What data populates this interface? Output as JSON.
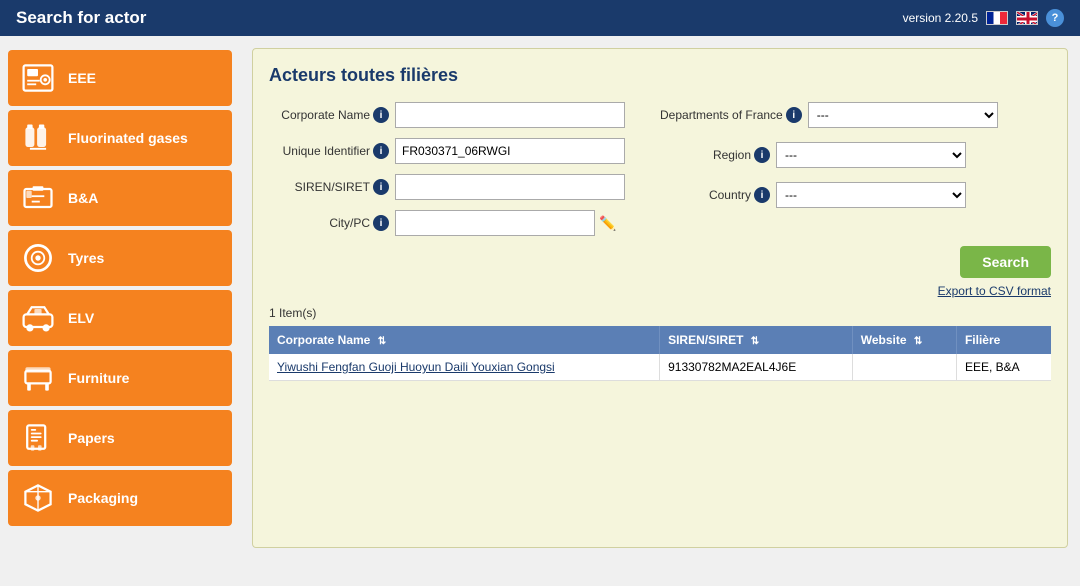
{
  "header": {
    "title": "Search for actor",
    "version": "version 2.20.5"
  },
  "sidebar": {
    "items": [
      {
        "id": "eee",
        "label": "EEE",
        "icon": "washer"
      },
      {
        "id": "fluorinated-gases",
        "label": "Fluorinated gases",
        "icon": "gas"
      },
      {
        "id": "bna",
        "label": "B&A",
        "icon": "battery"
      },
      {
        "id": "tyres",
        "label": "Tyres",
        "icon": "tyre"
      },
      {
        "id": "elv",
        "label": "ELV",
        "icon": "car"
      },
      {
        "id": "furniture",
        "label": "Furniture",
        "icon": "furniture"
      },
      {
        "id": "papers",
        "label": "Papers",
        "icon": "papers"
      },
      {
        "id": "packaging",
        "label": "Packaging",
        "icon": "packaging"
      }
    ]
  },
  "panel": {
    "title": "Acteurs toutes filières",
    "form": {
      "corporate_name_label": "Corporate Name",
      "unique_identifier_label": "Unique Identifier",
      "siren_siret_label": "SIREN/SIRET",
      "city_pc_label": "City/PC",
      "departments_label": "Departments of France",
      "region_label": "Region",
      "country_label": "Country",
      "corporate_name_value": "",
      "unique_identifier_value": "FR030371_06RWGI",
      "siren_siret_value": "",
      "city_pc_value": "",
      "departments_value": "---",
      "region_value": "---",
      "country_value": "---",
      "departments_options": [
        "---"
      ],
      "region_options": [
        "---"
      ],
      "country_options": [
        "---"
      ]
    },
    "search_button": "Search",
    "export_link": "Export to CSV format",
    "results_count": "1 Item(s)",
    "table": {
      "columns": [
        "Corporate Name",
        "SIREN/SIRET",
        "Website",
        "Filière"
      ],
      "rows": [
        {
          "corporate_name": "Yiwushi Fengfan Guoji Huoyun Daili Youxian Gongsi",
          "siren_siret": "91330782MA2EAL4J6E",
          "website": "",
          "filiere": "EEE, B&A"
        }
      ]
    }
  }
}
